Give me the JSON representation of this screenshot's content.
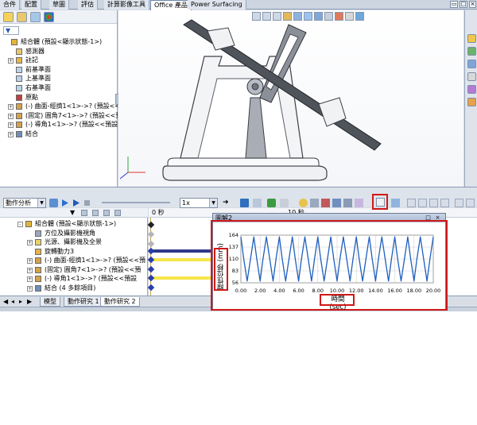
{
  "tabs": [
    {
      "label": "合件"
    },
    {
      "label": "配置"
    },
    {
      "label": "草圖"
    },
    {
      "label": "評估"
    },
    {
      "label": "計算影像工具"
    },
    {
      "label": "Office 產品"
    },
    {
      "label": "Power Surfacing"
    }
  ],
  "active_tab_index": 5,
  "feature_tree": {
    "filter_glyph": "▼",
    "items": [
      {
        "label": "組合體 (預設<顯示狀態-1>)",
        "expander": "",
        "icon": "assembly-icon",
        "indent": 0
      },
      {
        "label": "感測器",
        "expander": "",
        "icon": "sensor-folder-icon",
        "indent": 1
      },
      {
        "label": "註記",
        "expander": "+",
        "icon": "annotation-icon",
        "indent": 1
      },
      {
        "label": "前基準面",
        "expander": "",
        "icon": "plane-icon",
        "indent": 1
      },
      {
        "label": "上基準面",
        "expander": "",
        "icon": "plane-icon",
        "indent": 1
      },
      {
        "label": "右基準面",
        "expander": "",
        "icon": "plane-icon",
        "indent": 1
      },
      {
        "label": "原點",
        "expander": "",
        "icon": "origin-icon",
        "indent": 1
      },
      {
        "label": "(-) 曲面-經擠1<1>->? (預設<<預設",
        "expander": "+",
        "icon": "part-icon",
        "indent": 1
      },
      {
        "label": "(固定) 圓角7<1>->? (預設<<預設",
        "expander": "+",
        "icon": "part-icon",
        "indent": 1
      },
      {
        "label": "(-) 導角1<1>->? (預設<<預設>_顯示",
        "expander": "+",
        "icon": "part-icon",
        "indent": 1
      },
      {
        "label": "結合",
        "expander": "+",
        "icon": "mates-icon",
        "indent": 1
      }
    ]
  },
  "motion_toolbar": {
    "study_type": "動作分析",
    "unit_select": "1x"
  },
  "motion_tree": {
    "items": [
      {
        "label": "組合體 (預設<顯示狀態-1>)",
        "expander": "-",
        "icon": "assembly-icon",
        "indent": 0
      },
      {
        "label": "方位及攝影機視角",
        "expander": "",
        "icon": "camera-icon",
        "indent": 1
      },
      {
        "label": "光源、攝影機及全景",
        "expander": "+",
        "icon": "lights-icon",
        "indent": 1
      },
      {
        "label": "旋轉動力3",
        "expander": "",
        "icon": "motor-icon",
        "indent": 1
      },
      {
        "label": "(-) 曲面-經擠1<1>->? (預設<<預",
        "expander": "+",
        "icon": "part-icon",
        "indent": 1
      },
      {
        "label": "(固定) 圓角7<1>->? (預設<<預",
        "expander": "+",
        "icon": "part-icon",
        "indent": 1
      },
      {
        "label": "(-) 導角1<1>->? (預設<<預設",
        "expander": "+",
        "icon": "part-icon",
        "indent": 1
      },
      {
        "label": "結合 (4 多餘項目)",
        "expander": "+",
        "icon": "mates-icon",
        "indent": 1
      }
    ]
  },
  "timeline": {
    "time_zero_label": "0 秒",
    "partial_tick_label": "10 秒"
  },
  "bottom_tabs": [
    {
      "label": "模型"
    },
    {
      "label": "動作研究 1"
    },
    {
      "label": "動作研究 2"
    }
  ],
  "graph": {
    "window_title": "圖解2",
    "close_glyph": "×",
    "minimize_glyph": "_",
    "restore_glyph": "□"
  },
  "chart_data": {
    "type": "line",
    "title": "",
    "xlabel": "時間 (sec)",
    "ylabel": "線性位移 (mm)",
    "xlim": [
      0,
      20
    ],
    "ylim": [
      56,
      164
    ],
    "x_ticks": [
      "0.00",
      "2.00",
      "4.00",
      "6.00",
      "8.00",
      "10.00",
      "12.00",
      "14.00",
      "16.00",
      "18.00",
      "20.00"
    ],
    "y_ticks": [
      "164",
      "137",
      "110",
      "83",
      "56"
    ],
    "grid": true,
    "series": [
      {
        "color": "#1f5fbf",
        "x": [
          0,
          0.3,
          0.65,
          1.0,
          1.35,
          1.65,
          2.0,
          2.3,
          2.65,
          3.0,
          3.35,
          3.65,
          4.0,
          4.3,
          4.65,
          5.0,
          5.35,
          5.65,
          6.0,
          6.3,
          6.65,
          7.0,
          7.35,
          7.65,
          8.0,
          8.3,
          8.65,
          9.0,
          9.35,
          9.65,
          10.0,
          10.3,
          10.65,
          11.0,
          11.35,
          11.65,
          12.0,
          12.3,
          12.65,
          13.0,
          13.35,
          13.65,
          14.0,
          14.3,
          14.65,
          15.0,
          15.35,
          15.65,
          16.0,
          16.3,
          16.65,
          17.0,
          17.35,
          17.65,
          18.0,
          18.3,
          18.65,
          19.0,
          19.35,
          19.65,
          20.0
        ],
        "y": [
          160,
          110,
          60,
          110,
          160,
          110,
          60,
          110,
          160,
          110,
          60,
          110,
          160,
          110,
          60,
          110,
          160,
          110,
          60,
          110,
          160,
          110,
          60,
          110,
          160,
          110,
          60,
          110,
          160,
          110,
          60,
          110,
          160,
          110,
          60,
          110,
          160,
          110,
          60,
          110,
          160,
          110,
          60,
          110,
          160,
          110,
          60,
          110,
          160,
          110,
          60,
          110,
          160,
          110,
          60,
          110,
          160,
          110,
          60,
          110,
          160
        ]
      }
    ]
  }
}
